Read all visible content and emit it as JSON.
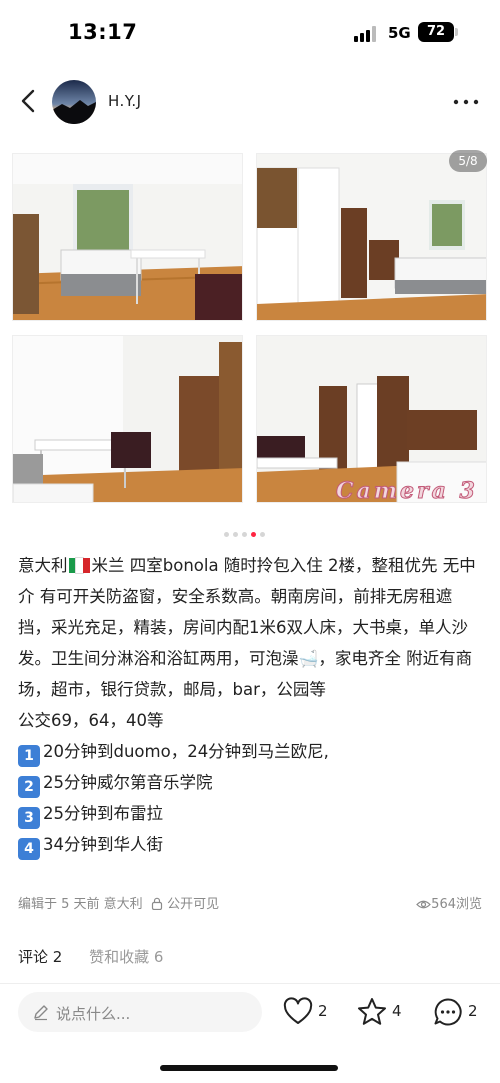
{
  "status_bar": {
    "time": "13:17",
    "network": "5G",
    "battery": "72"
  },
  "header": {
    "username": "H.Y.J"
  },
  "gallery": {
    "counter": "5/8",
    "watermark": "Camera 3",
    "dots": 5,
    "active_dot": 3
  },
  "post": {
    "line1_pre": "意大利",
    "line1_post": "米兰 四室bonola 随时拎包入住 2楼，整租优先 无中介 有可开关防盗窗，安全系数高。朝南房间，前排无房租遮挡，采光充足，精装，房间内配1米6双人床，大书桌，单人沙发。卫生间分淋浴和浴缸两用，可泡澡",
    "line1_tail": "，家电齐全 附近有商场，超市，银行贷款，邮局，bar，公园等",
    "bus": "公交69，64，40等",
    "routes": [
      {
        "num": "1",
        "text": "20分钟到duomo，24分钟到马兰欧尼,"
      },
      {
        "num": "2",
        "text": "25分钟威尔第音乐学院"
      },
      {
        "num": "3",
        "text": "25分钟到布雷拉"
      },
      {
        "num": "4",
        "text": "34分钟到华人街"
      }
    ]
  },
  "meta": {
    "edited": "编辑于 5 天前 意大利",
    "visibility": "公开可见",
    "views": "564浏览"
  },
  "tabs": {
    "comments": "评论 2",
    "likes": "赞和收藏 6"
  },
  "bottom_bar": {
    "placeholder": "说点什么...",
    "like_count": "2",
    "star_count": "4",
    "comment_count": "2"
  },
  "colors": {
    "accent": "#ff2442",
    "keycap": "#3d7fd6"
  }
}
